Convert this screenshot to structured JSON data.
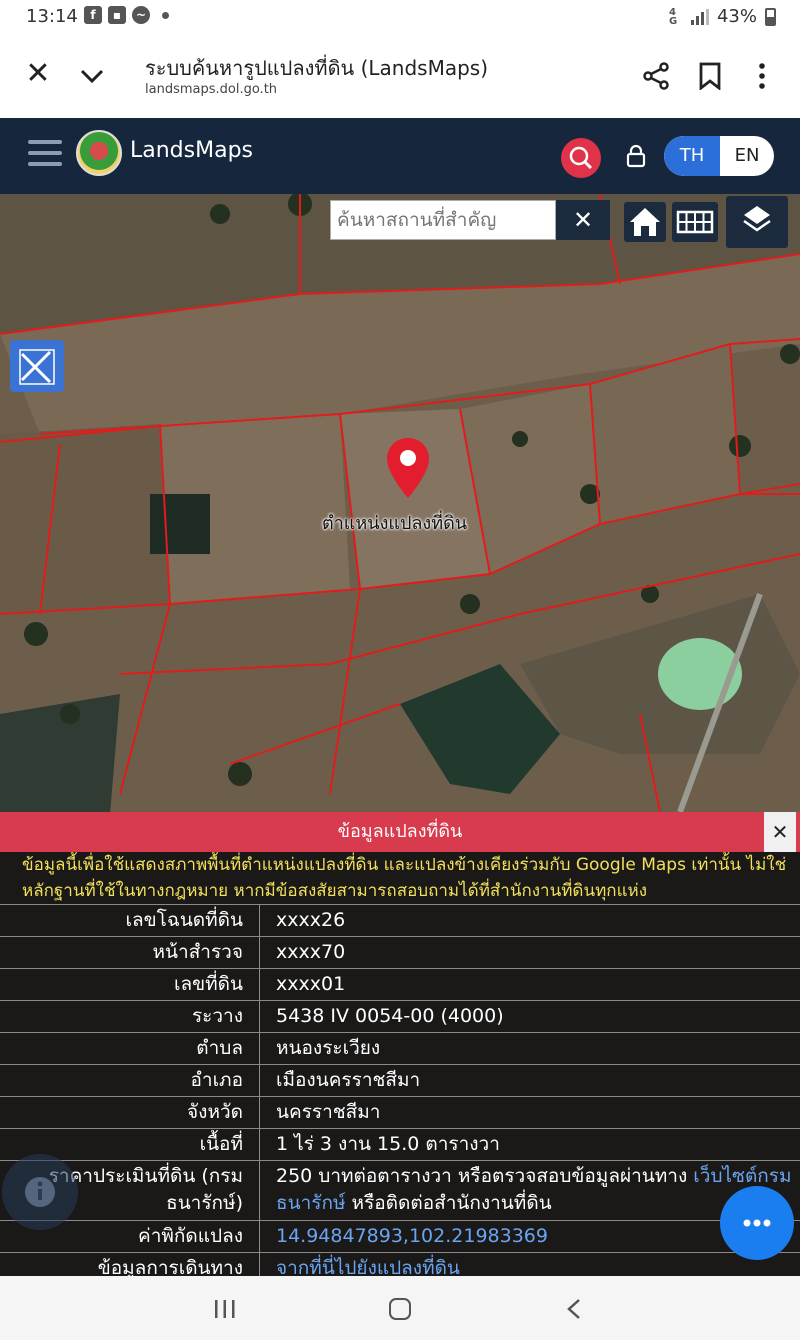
{
  "status_bar": {
    "time": "13:14",
    "network": "4G",
    "battery": "43%"
  },
  "browser": {
    "page_title": "ระบบค้นหารูปแปลงที่ดิน (LandsMaps)",
    "url": "landsmaps.dol.go.th"
  },
  "app": {
    "brand": "LandsMaps",
    "lang_th": "TH",
    "lang_en": "EN",
    "accent_color": "#e0334a",
    "header_color": "#16263c"
  },
  "map": {
    "search_placeholder": "ค้นหาสถานที่สำคัญ",
    "clear_label": "✕",
    "pin_label": "ตำแหน่งแปลงที่ดิน"
  },
  "panel": {
    "title": "ข้อมูลแปลงที่ดิน",
    "close_label": "✕",
    "disclaimer": "ข้อมูลนี้เพื่อใช้แสดงสภาพพื้นที่ตำแหน่งแปลงที่ดิน และแปลงข้างเคียงร่วมกับ Google Maps เท่านั้น ไม่ใช่หลักฐานที่ใช้ในทางกฎหมาย หากมีข้อสงสัยสามารถสอบถามได้ที่สำนักงานที่ดินทุกแห่ง",
    "rows": [
      {
        "key": "เลขโฉนดที่ดิน",
        "value": "xxxx26"
      },
      {
        "key": "หน้าสำรวจ",
        "value": "xxxx70"
      },
      {
        "key": "เลขที่ดิน",
        "value": "xxxx01"
      },
      {
        "key": "ระวาง",
        "value": "5438 IV 0054-00 (4000)"
      },
      {
        "key": "ตำบล",
        "value": "หนองระเวียง"
      },
      {
        "key": "อำเภอ",
        "value": "เมืองนครราชสีมา"
      },
      {
        "key": "จังหวัด",
        "value": "นครราชสีมา"
      },
      {
        "key": "เนื้อที่",
        "value": "1 ไร่ 3 งาน 15.0 ตารางวา"
      }
    ],
    "price": {
      "key": "ราคาประเมินที่ดิน (กรมธนารักษ์)",
      "value_prefix": "250 บาทต่อตารางวา หรือตรวจสอบข้อมูลผ่านทาง ",
      "value_link": "เว็บไซต์กรมธนารักษ์",
      "value_suffix": " หรือติดต่อสำนักงานที่ดิน"
    },
    "coords": {
      "key": "ค่าพิกัดแปลง",
      "value": "14.94847893,102.21983369"
    },
    "directions": {
      "key": "ข้อมูลการเดินทาง",
      "value": "จากที่นี่ไปยังแปลงที่ดิน"
    }
  }
}
